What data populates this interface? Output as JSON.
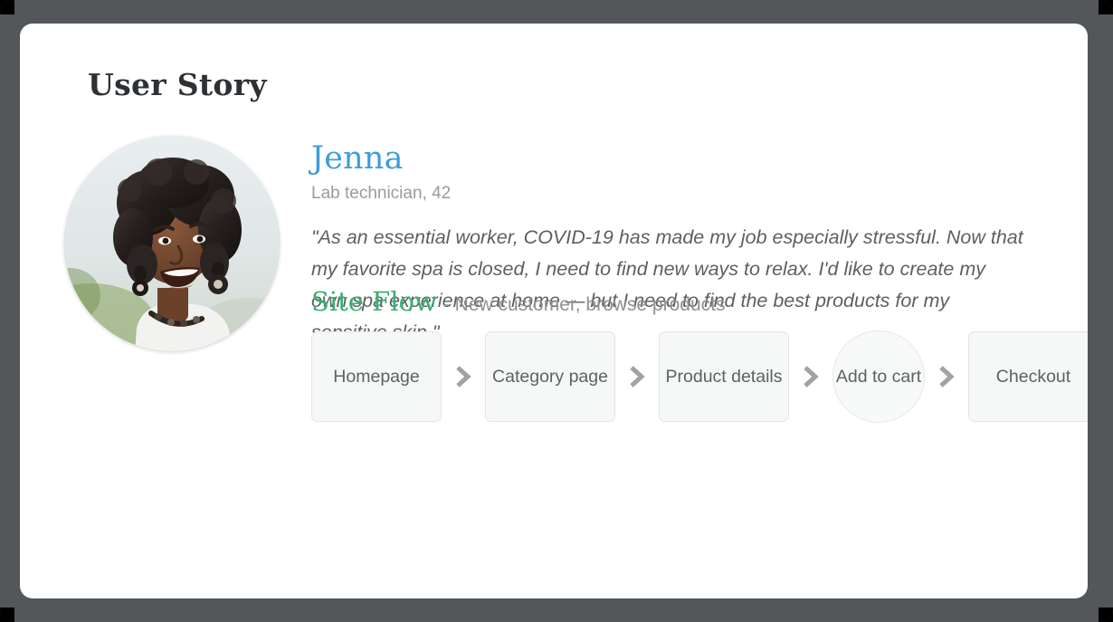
{
  "page": {
    "title": "User Story"
  },
  "persona": {
    "name": "Jenna",
    "role": "Lab technician, 42",
    "quote": "\"As an essential worker, COVID-19 has made my job especially stressful. Now that my favorite spa is closed, I need to find new ways to relax. I'd like to create my own spa experience at home — but I need to find the best products for my sensitive skin.\"",
    "avatar_alt": "Portrait of a smiling woman outdoors"
  },
  "site_flow": {
    "title": "Site Flow",
    "subtitle": "- New customer, browse products",
    "separator_icon": "chevron-right-icon",
    "steps": [
      {
        "label": "Homepage",
        "shape": "rect"
      },
      {
        "label": "Category page",
        "shape": "rect"
      },
      {
        "label": "Product details",
        "shape": "rect"
      },
      {
        "label": "Add to cart",
        "shape": "circle"
      },
      {
        "label": "Checkout",
        "shape": "stack"
      }
    ]
  },
  "colors": {
    "accent_blue": "#3e9ddb",
    "accent_green": "#38b06f",
    "backdrop": "#53575a",
    "card": "#ffffff",
    "node_fill": "#f6f7f7",
    "node_border": "#e3e5e6",
    "text_dark": "#2e3133",
    "text_muted": "#8e9194"
  }
}
